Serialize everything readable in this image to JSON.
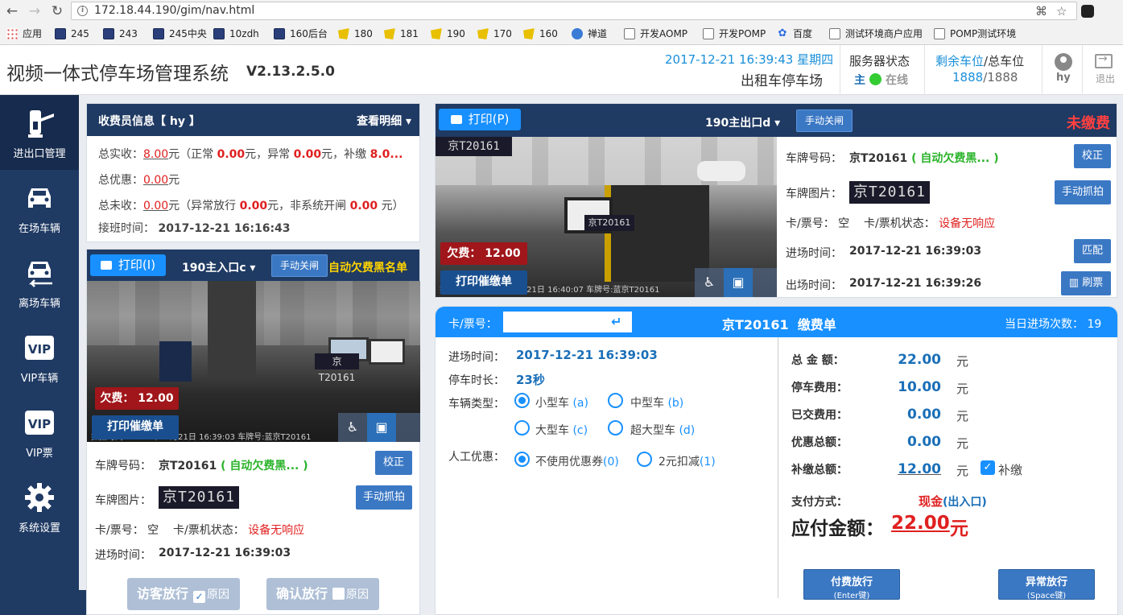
{
  "browser": {
    "url": "172.18.44.190/gim/nav.html",
    "bookmarks": [
      {
        "label": "应用",
        "icon": "apps-grid-icon"
      },
      {
        "label": "245",
        "icon": "bookmark-icon"
      },
      {
        "label": "243",
        "icon": "bookmark-icon"
      },
      {
        "label": "245中央",
        "icon": "bookmark-icon"
      },
      {
        "label": "10zdh",
        "icon": "bookmark-icon"
      },
      {
        "label": "160后台",
        "icon": "bookmark-icon"
      },
      {
        "label": "180",
        "icon": "folder-icon"
      },
      {
        "label": "181",
        "icon": "folder-icon"
      },
      {
        "label": "190",
        "icon": "folder-icon"
      },
      {
        "label": "170",
        "icon": "folder-icon"
      },
      {
        "label": "160",
        "icon": "folder-icon"
      },
      {
        "label": "禅道",
        "icon": "globe-icon"
      },
      {
        "label": "开发AOMP",
        "icon": "page-icon"
      },
      {
        "label": "开发POMP",
        "icon": "page-icon"
      },
      {
        "label": "百度",
        "icon": "paw-icon"
      },
      {
        "label": "测试环境商户应用",
        "icon": "page-icon"
      },
      {
        "label": "POMP测试环境",
        "icon": "page-icon"
      }
    ]
  },
  "header": {
    "title": "视频一体式停车场管理系统",
    "version": "V2.13.2.5.0",
    "datetime": "2017-12-21 16:39:43 星期四",
    "lot_name": "出租车停车场",
    "server_label": "服务器状态",
    "server_main": "主",
    "server_status": "在线",
    "spots_label_a": "剩余车位",
    "spots_label_b": "/总车位",
    "spots_remaining": "1888",
    "spots_total": "/1888",
    "user": "hy",
    "logout": "退出"
  },
  "sidebar": {
    "items": [
      {
        "label": "进出口管理",
        "icon": "gate-barrier-icon"
      },
      {
        "label": "在场车辆",
        "icon": "car-icon"
      },
      {
        "label": "离场车辆",
        "icon": "car-leave-icon"
      },
      {
        "label": "VIP车辆",
        "icon": "vip-icon"
      },
      {
        "label": "VIP票",
        "icon": "vip-icon"
      },
      {
        "label": "系统设置",
        "icon": "gear-icon"
      }
    ]
  },
  "cashier": {
    "title": "收费员信息【 hy 】",
    "detail": "查看明细",
    "total_actual_label": "总实收：",
    "total_actual": "8.00",
    "normal_label": "元（正常",
    "normal": "0.00",
    "abnormal_label": "元，异常",
    "abnormal": "0.00",
    "supplement_label": "元，补缴",
    "supplement": "8.0...",
    "discount_label": "总优惠：",
    "discount": "0.00",
    "yuan": "元",
    "uncollected_label": "总未收：",
    "uncollected": "0.00",
    "abn_release_label": "元（异常放行",
    "abn_release": "0.00",
    "non_system_label": "元，非系统开闸",
    "non_system": "0.00",
    "non_system_tail": "元）",
    "shift_label": "接班时间：",
    "shift_time": "2017-12-21 16:16:43"
  },
  "entry": {
    "print": "打印(I)",
    "channel": "190主入口c",
    "close_gate": "手动关闸",
    "blacklist": "自动欠费黑名单",
    "arrears": "欠费： 12.00",
    "urge": "打印催缴单",
    "overlay": "抓拍时间：2017年12月21日 16:39:03 车牌号:蓝京T20161",
    "plate_label": "车牌号码：",
    "plate": "京T20161",
    "plate_note": "( 自动欠费黑... )",
    "correct": "校正",
    "img_label": "车牌图片：",
    "plate_img": "京T20161",
    "capture": "手动抓拍",
    "card_label": "卡/票号：",
    "card": "空",
    "card_state_label": "卡/票机状态：",
    "card_state": "设备无响应",
    "in_label": "进场时间：",
    "in_time": "2017-12-21 16:39:03",
    "visitor": "访客放行",
    "reason": "原因",
    "confirm": "确认放行"
  },
  "exit": {
    "print": "打印(P)",
    "channel": "190主出口d",
    "close_gate": "手动关闸",
    "unpaid": "未缴费",
    "arrears": "欠费： 12.00",
    "urge": "打印催缴单",
    "overlay": "抓拍时间：2017年12月21日 16:40:07 车牌号:蓝京T20161",
    "plate_label": "车牌号码：",
    "plate": "京T20161",
    "plate_note": "( 自动欠费黑... )",
    "correct": "校正",
    "img_label": "车牌图片：",
    "plate_img": "京T20161",
    "capture": "手动抓拍",
    "card_label": "卡/票号：",
    "card": "空",
    "card_state_label": "卡/票机状态：",
    "card_state": "设备无响应",
    "in_label": "进场时间：",
    "in_time": "2017-12-21 16:39:03",
    "match": "匹配",
    "out_label": "出场时间：",
    "out_time": "2017-12-21 16:39:26",
    "swipe": "刷票"
  },
  "fee": {
    "card_label": "卡/票号：",
    "card_value": "",
    "title": "京T20161  缴费单",
    "visits_label": "当日进场次数：",
    "visits": "19",
    "in_label": "进场时间：",
    "in_time": "2017-12-21 16:39:03",
    "duration_label": "停车时长：",
    "duration": "23秒",
    "type_label": "车辆类型：",
    "types": [
      {
        "label": "小型车",
        "key": "(a)",
        "checked": true
      },
      {
        "label": "中型车",
        "key": "(b)",
        "checked": false
      },
      {
        "label": "大型车",
        "key": "(c)",
        "checked": false
      },
      {
        "label": "超大型车",
        "key": "(d)",
        "checked": false
      }
    ],
    "discount_label": "人工优惠：",
    "discounts": [
      {
        "label": "不使用优惠券",
        "key": "(0)",
        "checked": true
      },
      {
        "label": "2元扣减",
        "key": "(1)",
        "checked": false
      }
    ],
    "total_label": "总 金 额：",
    "total": "22.00",
    "parking_label": "停车费用：",
    "parking": "10.00",
    "paid_label": "已交费用：",
    "paid": "0.00",
    "disc_label": "优惠总额：",
    "disc": "0.00",
    "supp_label": "补缴总额：",
    "supp": "12.00",
    "supp_check": "补缴",
    "yuan": "元",
    "method_label": "支付方式：",
    "method": "现金",
    "method_note": "(出入口)",
    "due_label": "应付金额：",
    "due": "22.00",
    "due_unit": "元",
    "pay_main": "付费放行",
    "pay_sub": "(Enter键)",
    "abn_main": "异常放行",
    "abn_sub": "(Space键)"
  }
}
